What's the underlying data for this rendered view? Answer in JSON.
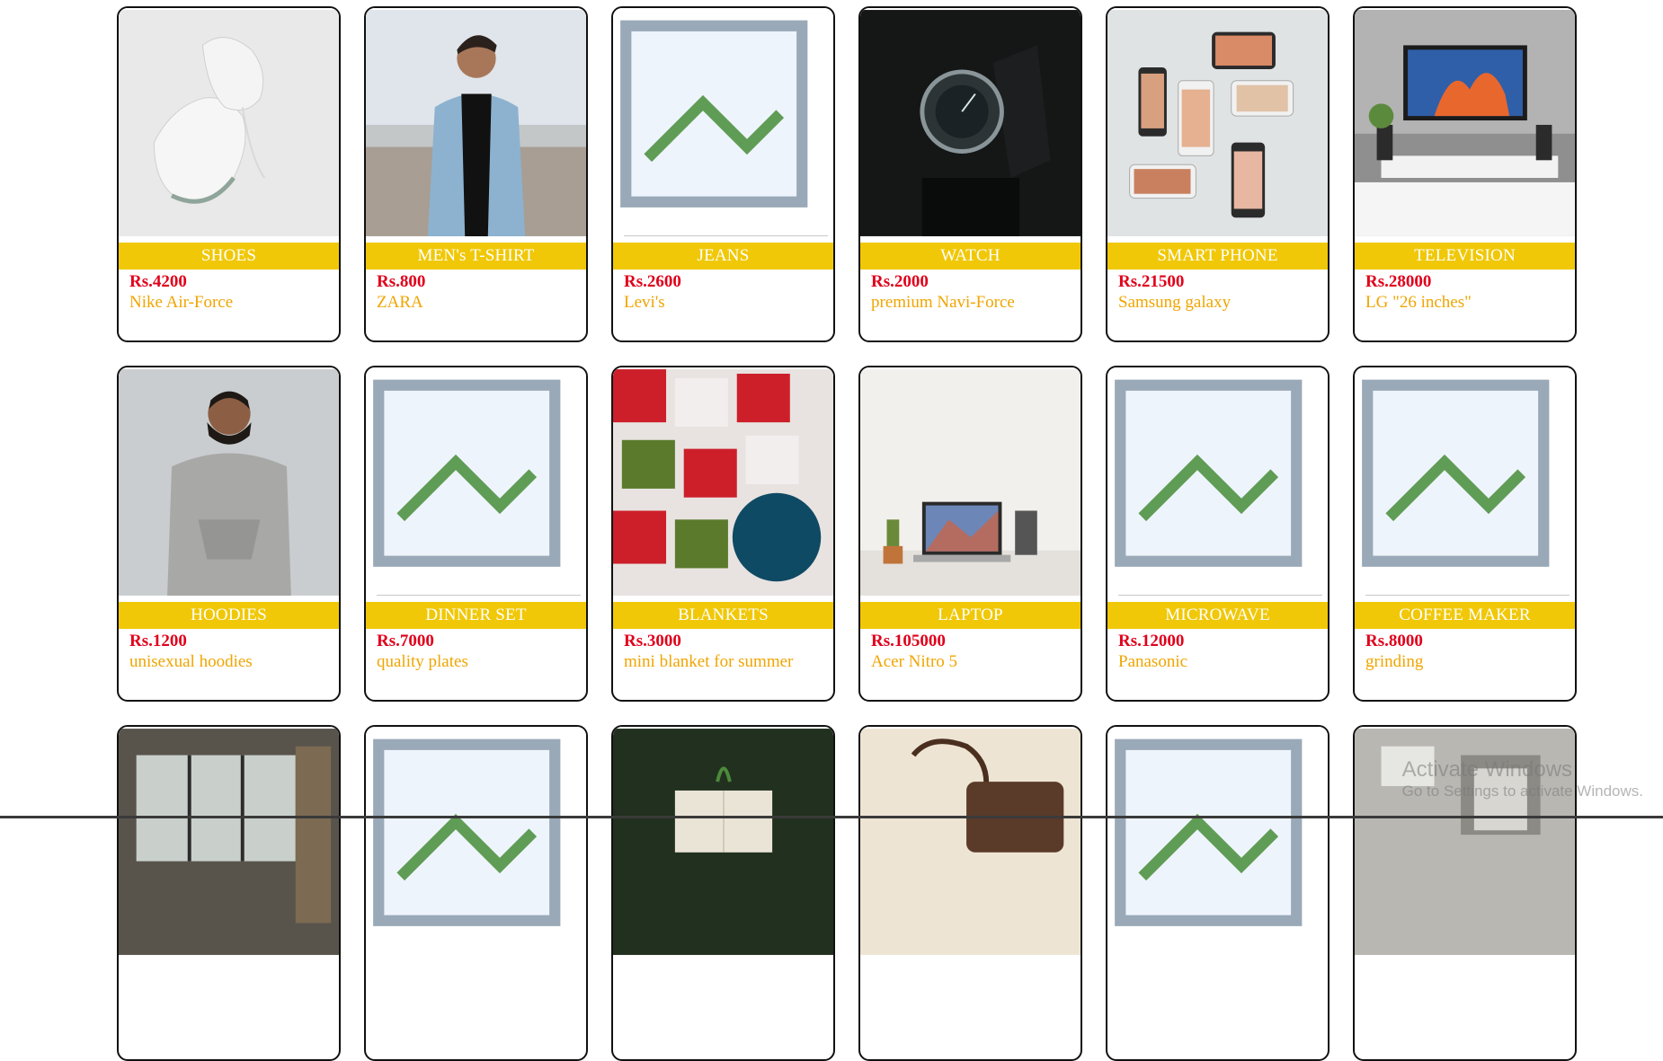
{
  "products": [
    {
      "category": "SHOES",
      "price": "Rs.4200",
      "desc": "Nike Air-Force",
      "image": "shoes-photo"
    },
    {
      "category": "MEN's T-SHIRT",
      "price": "Rs.800",
      "desc": "ZARA",
      "image": "man-jacket-photo"
    },
    {
      "category": "JEANS",
      "price": "Rs.2600",
      "desc": "Levi's",
      "image": "broken-image"
    },
    {
      "category": "WATCH",
      "price": "Rs.2000",
      "desc": "premium Navi-Force",
      "image": "watch-photo"
    },
    {
      "category": "SMART PHONE",
      "price": "Rs.21500",
      "desc": "Samsung galaxy",
      "image": "phones-photo"
    },
    {
      "category": "TELEVISION",
      "price": "Rs.28000",
      "desc": "LG \"26 inches\"",
      "image": "monitor-photo"
    },
    {
      "category": "HOODIES",
      "price": "Rs.1200",
      "desc": "unisexual hoodies",
      "image": "hoodie-photo"
    },
    {
      "category": "DINNER SET",
      "price": "Rs.7000",
      "desc": "quality plates",
      "image": "broken-image"
    },
    {
      "category": "BLANKETS",
      "price": "Rs.3000",
      "desc": "mini blanket for summer",
      "image": "blanket-photo"
    },
    {
      "category": "LAPTOP",
      "price": "Rs.105000",
      "desc": "Acer Nitro 5",
      "image": "laptop-photo"
    },
    {
      "category": "MICROWAVE",
      "price": "Rs.12000",
      "desc": "Panasonic",
      "image": "broken-image"
    },
    {
      "category": "COFFEE MAKER",
      "price": "Rs.8000",
      "desc": "grinding",
      "image": "broken-image"
    },
    {
      "image": "room-photo"
    },
    {
      "image": "broken-image"
    },
    {
      "image": "book-grass-photo"
    },
    {
      "image": "bag-photo"
    },
    {
      "image": "broken-image"
    },
    {
      "image": "office-photo"
    }
  ],
  "watermark": {
    "line1": "Activate Windows",
    "line2": "Go to Settings to activate Windows."
  },
  "colors": {
    "category_bar": "#f0c808",
    "price": "#e0001b",
    "desc": "#f0a500"
  }
}
